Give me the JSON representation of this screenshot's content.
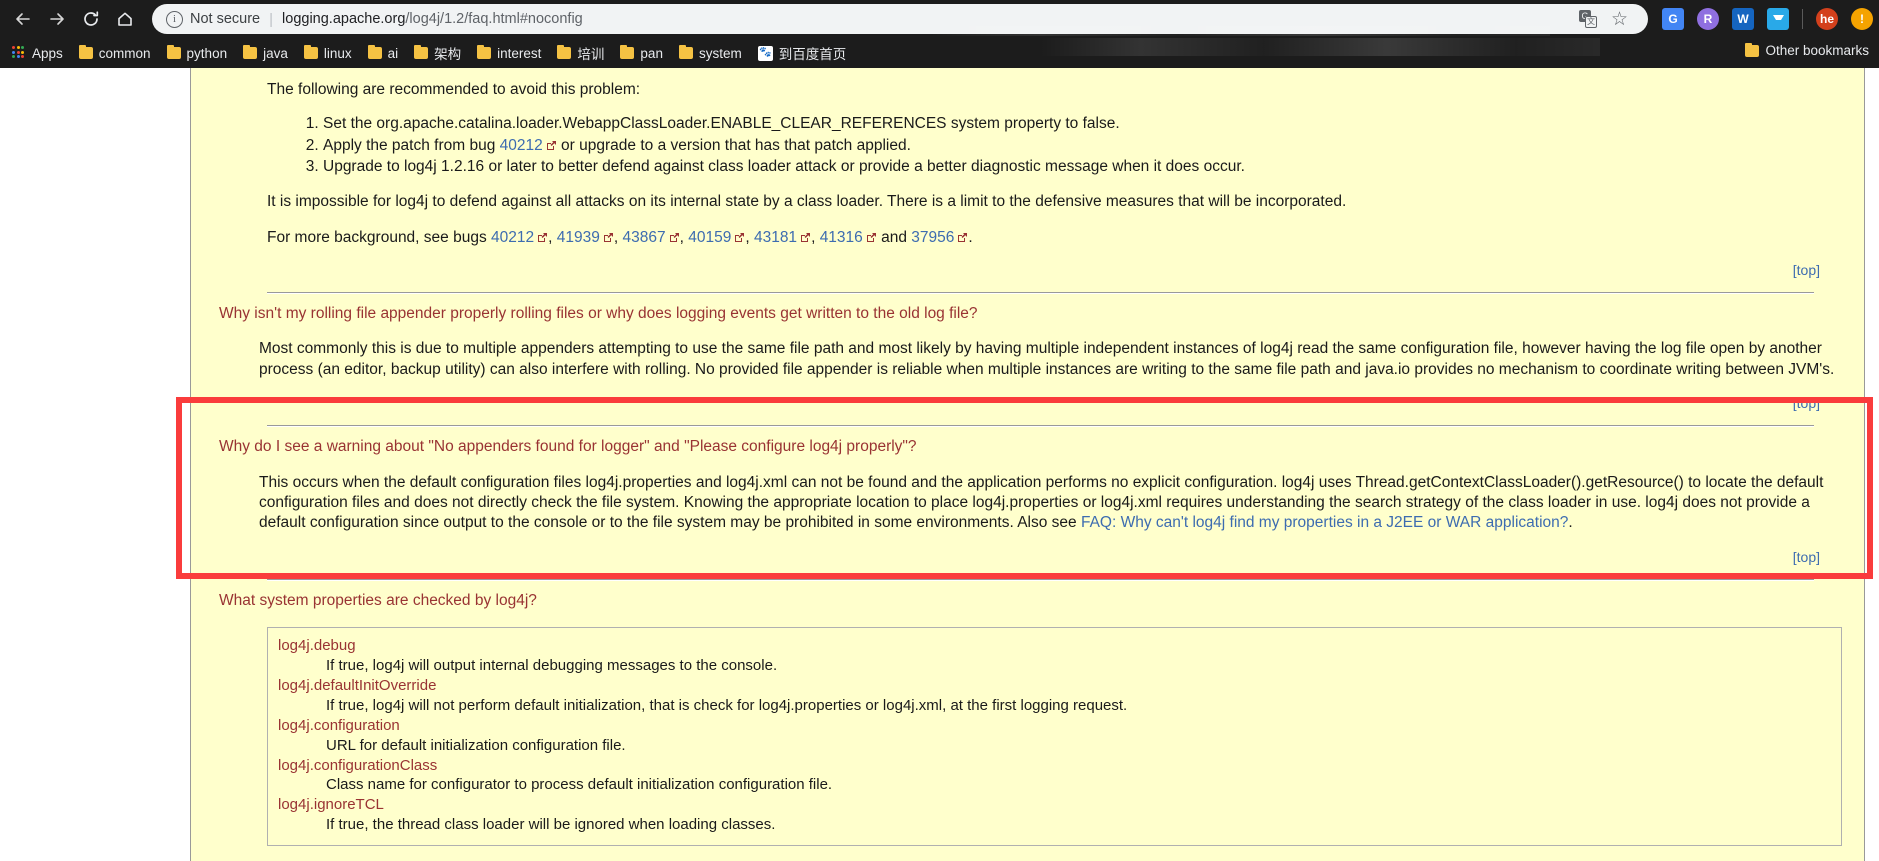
{
  "browser": {
    "nav": {
      "back": "back-arrow",
      "forward": "forward-arrow",
      "reload": "reload",
      "home": "home"
    },
    "omnibox": {
      "info_icon": "i",
      "security_label": "Not secure",
      "separator": "|",
      "url_host": "logging.apache.org",
      "url_path": "/log4j/1.2/faq.html#noconfig",
      "translate_icon_a": "G",
      "translate_icon_b": "文",
      "bookmark_star": "☆"
    },
    "extensions": [
      {
        "name": "google-translate-extension",
        "label": "G",
        "color": "#4285f4"
      },
      {
        "name": "r-extension",
        "label": "R",
        "color": "#8f6fe0",
        "round": true
      },
      {
        "name": "w-extension",
        "label": "W",
        "color": "#1565c0"
      },
      {
        "name": "pocket-extension",
        "label": "",
        "color": "#29a9e8"
      },
      {
        "name": "he-profile-avatar",
        "label": "he",
        "color": "#d3401c",
        "round": true
      },
      {
        "name": "alert-extension",
        "label": "!",
        "color": "#f5a300",
        "round": true
      }
    ]
  },
  "bookmarks": {
    "apps_label": "Apps",
    "items": [
      {
        "label": "common",
        "icon": "folder-icon"
      },
      {
        "label": "python",
        "icon": "folder-icon"
      },
      {
        "label": "java",
        "icon": "folder-icon"
      },
      {
        "label": "linux",
        "icon": "folder-icon"
      },
      {
        "label": "ai",
        "icon": "folder-icon"
      },
      {
        "label": "架构",
        "icon": "folder-icon"
      },
      {
        "label": "interest",
        "icon": "folder-icon"
      },
      {
        "label": "培训",
        "icon": "folder-icon"
      },
      {
        "label": "pan",
        "icon": "folder-icon"
      },
      {
        "label": "system",
        "icon": "folder-icon"
      },
      {
        "label": "到百度首页",
        "icon": "baidu-icon"
      }
    ],
    "other_label": "Other bookmarks"
  },
  "page": {
    "recommend_intro": "The following are recommended to avoid this problem:",
    "steps": [
      {
        "pre": "Set the org.apache.catalina.loader.WebappClassLoader.ENABLE_CLEAR_REFERENCES system property to false.",
        "link": "",
        "post": ""
      },
      {
        "pre": "Apply the patch from bug ",
        "link": "40212",
        "post": " or upgrade to a version that has that patch applied."
      },
      {
        "pre": "Upgrade to log4j 1.2.16 or later to better defend against class loader attack or provide a better diagnostic message when it does occur.",
        "link": "",
        "post": ""
      }
    ],
    "impossible_para": "It is impossible for log4j to defend against all attacks on its internal state by a class loader. There is a limit to the defensive measures that will be incorporated.",
    "background": {
      "prefix": "For more background, see bugs ",
      "bugs": [
        "40212",
        "41939",
        "43867",
        "40159",
        "43181",
        "41316",
        "37956"
      ],
      "conjunction": " and ",
      "suffix": "."
    },
    "top_label": "[top]",
    "faq_rolling": {
      "question": "Why isn't my rolling file appender properly rolling files or why does logging events get written to the old log file?",
      "answer": "Most commonly this is due to multiple appenders attempting to use the same file path and most likely by having multiple independent instances of log4j read the same configuration file, however having the log file open by another process (an editor, backup utility) can also interfere with rolling. No provided file appender is reliable when multiple instances are writing to the same file path and java.io provides no mechanism to coordinate writing between JVM's."
    },
    "faq_noconfig": {
      "question": "Why do I see a warning about \"No appenders found for logger\" and \"Please configure log4j properly\"?",
      "answer_part1": "This occurs when the default configuration files log4j.properties and log4j.xml can not be found and the application performs no explicit configuration. log4j uses Thread.getContextClassLoader().getResource() to locate the default configuration files and does not directly check the file system. Knowing the appropriate location to place log4j.properties or log4j.xml requires understanding the search strategy of the class loader in use. log4j does not provide a default configuration since output to the console or to the file system may be prohibited in some environments. Also see ",
      "answer_link": "FAQ: Why can't log4j find my properties in a J2EE or WAR application?",
      "answer_part2": ".",
      "highlight_color": "#fa3c3c"
    },
    "faq_sysprops": {
      "question": "What system properties are checked by log4j?",
      "properties": [
        {
          "name": "log4j.debug",
          "desc": "If true, log4j will output internal debugging messages to the console."
        },
        {
          "name": "log4j.defaultInitOverride",
          "desc": "If true, log4j will not perform default initialization, that is check for log4j.properties or log4j.xml, at the first logging request."
        },
        {
          "name": "log4j.configuration",
          "desc": "URL for default initialization configuration file."
        },
        {
          "name": "log4j.configurationClass",
          "desc": "Class name for configurator to process default initialization configuration file."
        },
        {
          "name": "log4j.ignoreTCL",
          "desc": "If true, the thread class loader will be ignored when loading classes."
        }
      ]
    }
  },
  "colors": {
    "page_background": "#FFFFCC",
    "heading_red": "#993333",
    "link_blue": "#3d6cb0",
    "highlight_red": "#fa3c3c",
    "chrome_dark": "#1c1c1c"
  }
}
